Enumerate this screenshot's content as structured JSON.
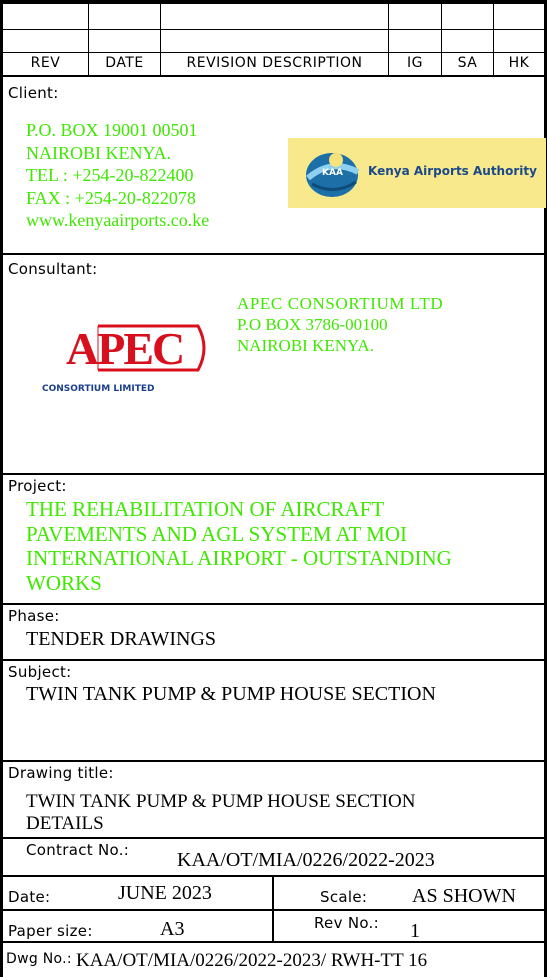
{
  "revision_table": {
    "headers": [
      "REV",
      "DATE",
      "REVISION DESCRIPTION",
      "IG",
      "SA",
      "HK"
    ]
  },
  "client": {
    "label": "Client:",
    "lines": [
      "P.O. BOX 19001 00501",
      "NAIROBI KENYA.",
      "TEL : +254-20-822400",
      "FAX : +254-20-822078",
      "www.kenyaairports.co.ke"
    ],
    "logo": {
      "badge": "KAA",
      "name": "Kenya Airports Authority",
      "color": "#f9e98d"
    }
  },
  "consultant": {
    "label": "Consultant:",
    "lines": [
      "APEC CONSORTIUM LTD",
      "P.O BOX 3786-00100",
      "NAIROBI KENYA."
    ],
    "logo": {
      "mark": "APEC",
      "subtitle": "CONSORTIUM LIMITED",
      "mark_color": "#d8101e",
      "subtitle_color": "#1a3f8c"
    }
  },
  "project": {
    "label": "Project:",
    "lines": [
      "THE REHABILITATION OF AIRCRAFT",
      "PAVEMENTS AND AGL SYSTEM AT MOI",
      "INTERNATIONAL AIRPORT - OUTSTANDING",
      "WORKS"
    ]
  },
  "phase": {
    "label": "Phase:",
    "value": "TENDER DRAWINGS"
  },
  "subject": {
    "label": "Subject:",
    "value": "TWIN TANK PUMP & PUMP HOUSE SECTION"
  },
  "drawing_title": {
    "label": "Drawing title:",
    "lines": [
      "TWIN TANK PUMP & PUMP HOUSE SECTION",
      "DETAILS"
    ]
  },
  "contract": {
    "label": "Contract No.:",
    "value": "KAA/OT/MIA/0226/2022-2023"
  },
  "date": {
    "label": "Date:",
    "value": "JUNE 2023"
  },
  "scale": {
    "label": "Scale:",
    "value": "AS SHOWN"
  },
  "paper_size": {
    "label": "Paper size:",
    "value": "A3"
  },
  "rev_no": {
    "label": "Rev No.:",
    "value": "1"
  },
  "dwg_no": {
    "label": "Dwg No.:",
    "value": "KAA/OT/MIA/0226/2022-2023/ RWH-TT 16"
  },
  "colors": {
    "green_text": "#3fe800"
  }
}
